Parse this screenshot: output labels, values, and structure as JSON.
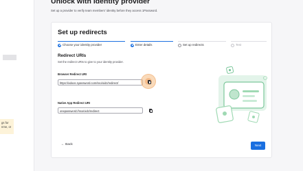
{
  "sidebar": {
    "note_text": "gs for\nnme, or"
  },
  "page": {
    "title": "Unlock with Identity provider",
    "subtitle": "Set up a provider to verify team members' identity before they access 1Password."
  },
  "modal": {
    "title": "Set up redirects",
    "steps": [
      {
        "label": "Choose your identity provider",
        "state": "done"
      },
      {
        "label": "Enter details",
        "state": "done"
      },
      {
        "label": "Set up redirects",
        "state": "current"
      },
      {
        "label": "Test",
        "state": "upcoming"
      }
    ],
    "section_title": "Redirect URIs",
    "section_desc": "Set the redirect URIs to give to your identity provider.",
    "fields": [
      {
        "label": "Browser Redirect URI",
        "value": "https://adoos.1password.com/sso/oidc/redirect/"
      },
      {
        "label": "Native App Redirect URI",
        "value": "onepassword://sso/oidc/redirect"
      }
    ],
    "back_label": "Back",
    "next_label": "Next"
  },
  "colors": {
    "accent": "#1a6fe0",
    "illustration_green": "#7cc79b",
    "highlight": "#f4bc82"
  },
  "icons": [
    "check-icon",
    "copy-icon",
    "arrow-left-icon",
    "illustration"
  ]
}
